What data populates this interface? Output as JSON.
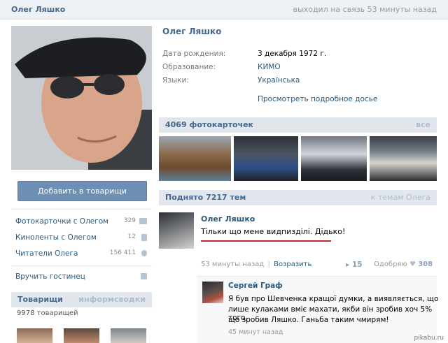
{
  "header": {
    "name": "Олег Ляшко",
    "status": "выходил на связь 53 минуты назад"
  },
  "sidebar": {
    "add_friend_label": "Добавить в товарищи",
    "links": [
      {
        "label": "Фотокарточки с Олегом",
        "count": "329"
      },
      {
        "label": "Киноленты с Олегом",
        "count": "12"
      },
      {
        "label": "Читатели Олега",
        "count": "156 411"
      },
      {
        "label": "Вручить гостинец",
        "count": ""
      }
    ],
    "friends": {
      "title": "Товарищи",
      "right": "информсводки",
      "count": "9978 товарищей"
    }
  },
  "profile": {
    "name": "Олег Ляшко",
    "info": [
      {
        "label": "Дата рождения:",
        "value": "3 декабря 1972 г."
      },
      {
        "label": "Образование:",
        "value": "КИМО"
      },
      {
        "label": "Языки:",
        "value": "Українська"
      }
    ],
    "dossier_link": "Просмотреть подробное досье"
  },
  "photos": {
    "title": "4069 фотокарточек",
    "all_link": "все"
  },
  "wall": {
    "title": "Поднято 7217 тем",
    "right_link": "к темам Олега",
    "post": {
      "author": "Олег Ляшко",
      "text": "Тільки що мене видпизділі. Дідько!",
      "time": "53 минуты назад",
      "separator": "|",
      "reply": "Возразить",
      "reposts": "15",
      "likes_label": "Одобряю",
      "likes": "308"
    },
    "comment": {
      "author": "Сергей Граф",
      "lines": [
        "Я був про Шевченка кращої думки, а виявляється, що",
        "лише кулаками вміє махати, якби він зробив хоч 5% того,",
        "що зробив Ляшко. Ганьба таким чмирям!"
      ],
      "time": "45 минут назад"
    }
  },
  "watermark": "pikabu.ru",
  "colors": {
    "link": "#2b587a",
    "header_bg": "#edf1f5",
    "section_bg": "#e1e7ed",
    "button_bg": "#6d8fb3",
    "highlight": "#c0292b"
  }
}
